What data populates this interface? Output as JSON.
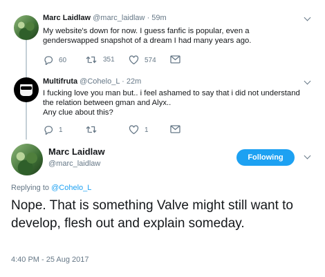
{
  "tweets": [
    {
      "name": "Marc Laidlaw",
      "handle": "@marc_laidlaw",
      "time": "59m",
      "text": "My website's down for now. I guess fanfic is popular, even a genderswapped snapshot of a dream I had many years ago.",
      "reply_count": "60",
      "retweet_count": "351",
      "like_count": "574"
    },
    {
      "name": "Multifruta",
      "handle": "@Cohelo_L",
      "time": "22m",
      "text_lines": [
        "I fucking love you man but.. i feel ashamed to say that i did not understand",
        "the relation between gman and Alyx..",
        "Any clue about this?"
      ],
      "reply_count": "1",
      "retweet_count": "",
      "like_count": "1"
    }
  ],
  "main_tweet": {
    "name": "Marc Laidlaw",
    "handle": "@marc_laidlaw",
    "follow_label": "Following",
    "replying_prefix": "Replying to",
    "replying_to": "@Cohelo_L",
    "text": "Nope. That is something Valve might still want to develop, flesh out and explain someday.",
    "timestamp": "4:40 PM - 25 Aug 2017"
  },
  "colors": {
    "accent": "#1da1f2",
    "secondary_text": "#657786",
    "thread_line": "#c4cfd6"
  },
  "icons": [
    "reply-icon",
    "retweet-icon",
    "like-icon",
    "dm-icon",
    "chevron-down-icon"
  ]
}
